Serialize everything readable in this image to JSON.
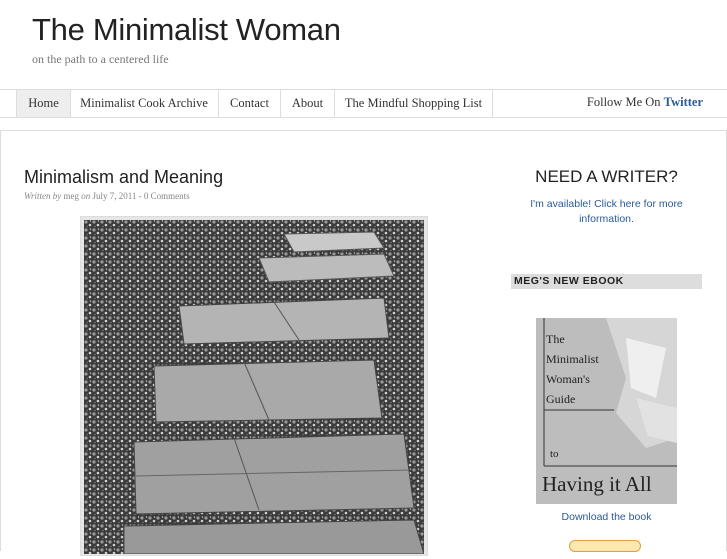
{
  "site": {
    "title": "The Minimalist Woman",
    "tagline": "on the path to a centered life"
  },
  "nav": {
    "items": [
      {
        "label": "Home"
      },
      {
        "label": "Minimalist Cook Archive"
      },
      {
        "label": "Contact"
      },
      {
        "label": "About"
      },
      {
        "label": "The Mindful Shopping List"
      }
    ],
    "follow_prefix": "Follow Me On",
    "follow_link": "Twitter"
  },
  "post": {
    "title": "Minimalism and Meaning",
    "written_by": "Written",
    "by": "by",
    "author": "meg",
    "on": "on",
    "date": "July 7, 2011",
    "separator": "-",
    "comments": "0 Comments"
  },
  "sidebar": {
    "writer_title": "NEED A WRITER?",
    "writer_text": "I'm available! Click here for more information.",
    "ebook_header": "MEG'S NEW EBOOK",
    "ebook_cover_lines": [
      "The",
      "Minimalist",
      "Woman's",
      "Guide",
      "to",
      "Having it All"
    ],
    "download_label": "Download the book"
  },
  "colors": {
    "link": "#2a5a9a",
    "nav_active_bg": "#eeeeee",
    "sidebar_bar": "#dddddd"
  }
}
